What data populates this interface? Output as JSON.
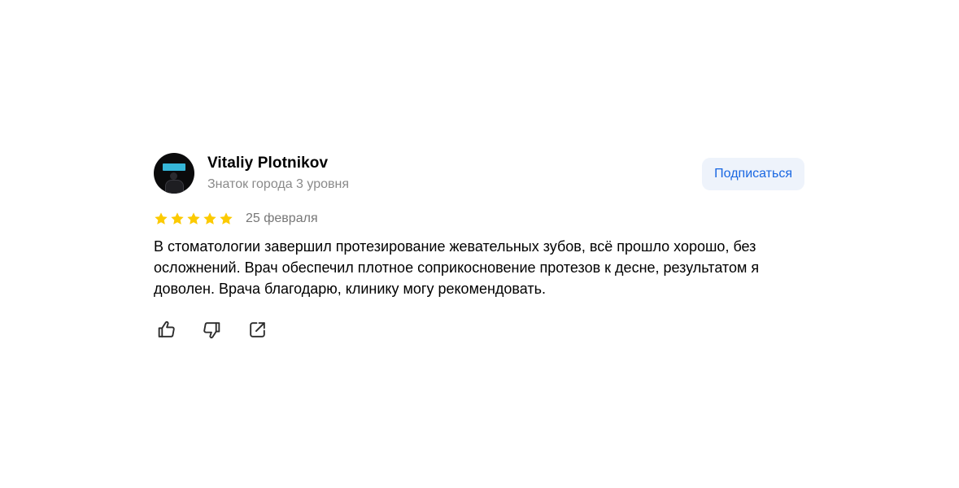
{
  "review": {
    "author": {
      "name": "Vitaliy Plotnikov",
      "level": "Знаток города 3 уровня"
    },
    "subscribe_label": "Подписаться",
    "rating": 5,
    "rating_max": 5,
    "date": "25 февраля",
    "text": "В стоматологии завершил протезирование жевательных зубов, всё прошло хорошо, без осложнений. Врач обеспечил плотное соприкосновение протезов к десне, результатом я доволен. Врача благодарю, клинику могу рекомендовать."
  },
  "icons": {
    "like": "thumbs-up-icon",
    "dislike": "thumbs-down-icon",
    "share": "share-icon",
    "star": "star-icon"
  },
  "colors": {
    "accent": "#1967e2",
    "button_bg": "#eef3fb",
    "star": "#fcca00",
    "muted": "#8a8a8a"
  }
}
